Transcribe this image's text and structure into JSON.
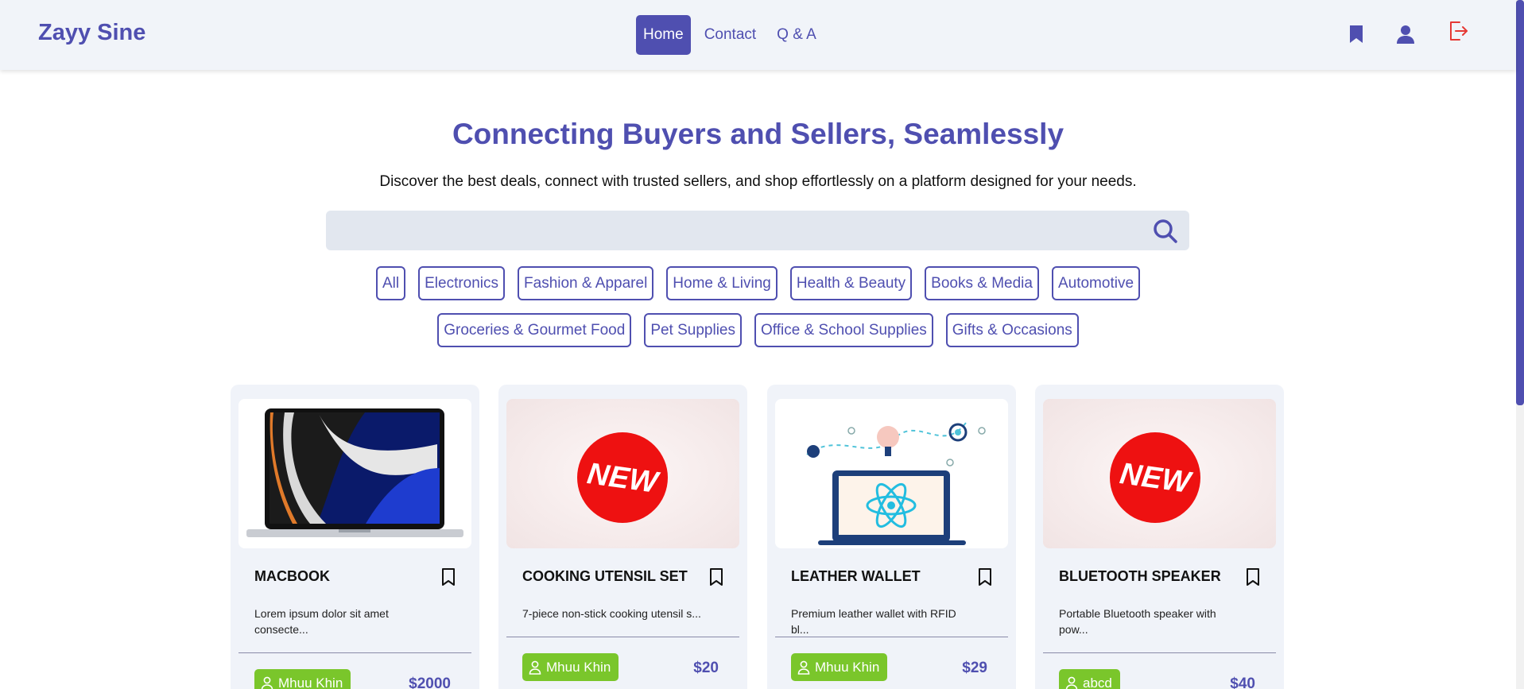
{
  "brand": "Zayy Sine",
  "nav": {
    "home": "Home",
    "contact": "Contact",
    "qa": "Q & A"
  },
  "hero": {
    "title": "Connecting Buyers and Sellers, Seamlessly",
    "subtitle": "Discover the best deals, connect with trusted sellers, and shop effortlessly on a platform designed for your needs."
  },
  "search": {
    "value": "",
    "placeholder": ""
  },
  "categories_row1": [
    "All",
    "Electronics",
    "Fashion & Apparel",
    "Home & Living",
    "Health & Beauty",
    "Books & Media",
    "Automotive"
  ],
  "categories_row2": [
    "Groceries & Gourmet Food",
    "Pet Supplies",
    "Office & School Supplies",
    "Gifts & Occasions"
  ],
  "products": [
    {
      "title": "MACBOOK",
      "description": "Lorem ipsum dolor sit amet consecte...",
      "seller": "Mhuu Khin",
      "price": "$2000",
      "image": "laptop"
    },
    {
      "title": "COOKING UTENSIL SET",
      "description": "7-piece non-stick cooking utensil s...",
      "seller": "Mhuu Khin",
      "price": "$20",
      "image": "new-badge"
    },
    {
      "title": "LEATHER WALLET",
      "description": "Premium leather wallet with RFID bl...",
      "seller": "Mhuu Khin",
      "price": "$29",
      "image": "react-illustration"
    },
    {
      "title": "BLUETOOTH SPEAKER",
      "description": "Portable Bluetooth speaker with pow...",
      "seller": "abcd",
      "price": "$40",
      "image": "new-badge"
    }
  ],
  "new_badge_text": "NEW",
  "colors": {
    "primary": "#4f4fb0",
    "seller_badge": "#7ac62b",
    "logout": "#e53935",
    "nav_bg": "#f1f4f9"
  }
}
